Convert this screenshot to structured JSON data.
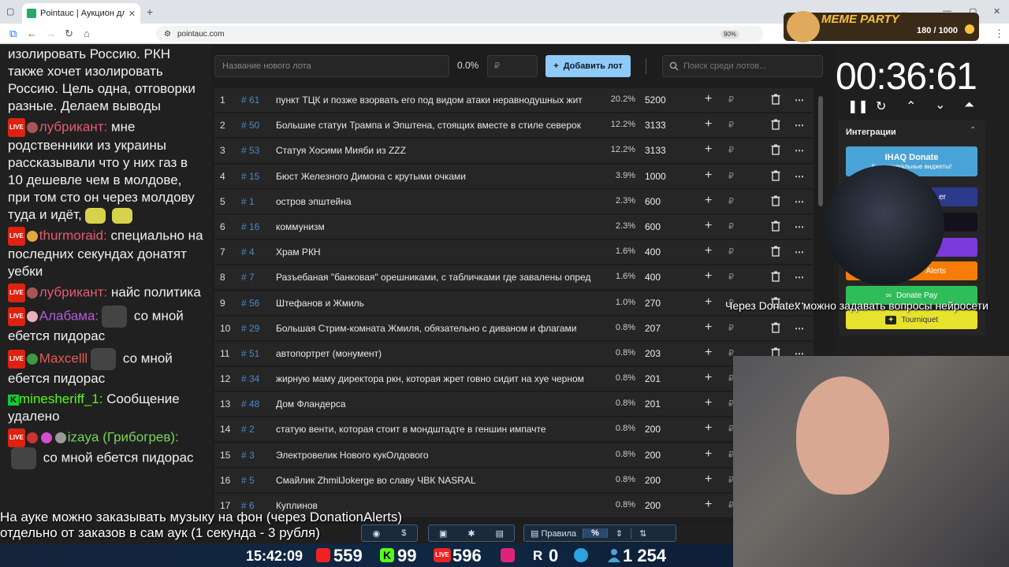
{
  "browser": {
    "tab_title": "Pointauc | Аукцион для стрима",
    "url": "pointauc.com",
    "zoom": "90%"
  },
  "meme_party": {
    "title": "MEME PARTY",
    "count": "180 / 1000"
  },
  "chat": {
    "line0": "изолировать Россию. РКН также хочет изолировать Россию. Цель одна, отговорки разные. Делаем выводы",
    "m1_user": "лубрикант:",
    "m1_text": " мне родственники из украины рассказывали что у них газ в 10 дешевле чем в молдове, при том сто он через молдову туда и идёт,",
    "m2_user": "thurmoraid:",
    "m2_text": " специально на последних секундах донатят уебки",
    "m3_user": "лубрикант:",
    "m3_text": " найс политика",
    "m4_user": "Алабама:",
    "m4_text": " со мной ебется пидорас",
    "m5_user": "Maxcelll",
    "m5_text": " со мной ебется пидорас",
    "m6_user": "minesheriff_1:",
    "m6_text": " Сообщение удалено",
    "m7_user": "izaya (Грибогрев):",
    "m7_text": " со мной ебется пидорас",
    "live_label": "LIVE",
    "kick_label": "K"
  },
  "controls": {
    "lot_placeholder": "Название нового лота",
    "total_percent": "0.0%",
    "amount_placeholder": "₽",
    "add_lot": "Добавить лот",
    "search_placeholder": "Поиск среди лотов..."
  },
  "lots": [
    {
      "n": "1",
      "id": "# 61",
      "name": "пункт ТЦК и позже взорвать его под видом атаки неравнодушных жит",
      "pct": "20.2%",
      "amt": "5200"
    },
    {
      "n": "2",
      "id": "# 50",
      "name": "Большие статуи Трампа и Эпштена, стоящих вместе в стиле северок",
      "pct": "12.2%",
      "amt": "3133"
    },
    {
      "n": "3",
      "id": "# 53",
      "name": "Статуя Хосими Мияби из ZZZ",
      "pct": "12.2%",
      "amt": "3133"
    },
    {
      "n": "4",
      "id": "# 15",
      "name": "Бюст Железного Димона с крутыми очками",
      "pct": "3.9%",
      "amt": "1000"
    },
    {
      "n": "5",
      "id": "# 1",
      "name": "остров эпштейна",
      "pct": "2.3%",
      "amt": "600"
    },
    {
      "n": "6",
      "id": "# 16",
      "name": "коммунизм",
      "pct": "2.3%",
      "amt": "600"
    },
    {
      "n": "7",
      "id": "# 4",
      "name": "Храм РКН",
      "pct": "1.6%",
      "amt": "400"
    },
    {
      "n": "8",
      "id": "# 7",
      "name": "Разъебаная \"банковая\" орешниками, с табличками где завалены опред",
      "pct": "1.6%",
      "amt": "400"
    },
    {
      "n": "9",
      "id": "# 56",
      "name": "Штефанов и Жмиль",
      "pct": "1.0%",
      "amt": "270"
    },
    {
      "n": "10",
      "id": "# 29",
      "name": "Большая Стрим-комната Жмиля, обязательно с диваном и флагами",
      "pct": "0.8%",
      "amt": "207"
    },
    {
      "n": "11",
      "id": "# 51",
      "name": "автопортрет (монумент)",
      "pct": "0.8%",
      "amt": "203"
    },
    {
      "n": "12",
      "id": "# 34",
      "name": "жирную маму директора ркн, которая жрет говно сидит на хуе черном",
      "pct": "0.8%",
      "amt": "201"
    },
    {
      "n": "13",
      "id": "# 48",
      "name": "Дом Фландерса",
      "pct": "0.8%",
      "amt": "201"
    },
    {
      "n": "14",
      "id": "# 2",
      "name": "статую венти, которая стоит в мондштадте в геншин импачте",
      "pct": "0.8%",
      "amt": "200"
    },
    {
      "n": "15",
      "id": "# 3",
      "name": "Электровелик Нового кукОлдового",
      "pct": "0.8%",
      "amt": "200"
    },
    {
      "n": "16",
      "id": "# 5",
      "name": "Смайлик ZhmilJokerge во славу ЧВК NASRAL",
      "pct": "0.8%",
      "amt": "200"
    },
    {
      "n": "17",
      "id": "# 6",
      "name": "Куплинов",
      "pct": "0.8%",
      "amt": "200"
    }
  ],
  "lot_currency": "₽",
  "timer": {
    "value": "00:36:61"
  },
  "integrations": {
    "title": "Интеграции",
    "ihaq": "IHAQ Donate",
    "ihaq_sub": "К... ...уникальные виджеты!",
    "b2": "...er",
    "b5": "Alerts",
    "donatepay": "Donate Pay",
    "tourniquet": "Tourniquet"
  },
  "overlay": {
    "donatex": "Через Donatex можно задавать вопросы нейросети",
    "music1": "На ауке можно заказывать музыку на фон (через DonationAlerts)",
    "music2": "отдельно от заказов в сам аук (1 секунда - 3 рубля)"
  },
  "toolbar": {
    "rules": "Правила",
    "percent": "%"
  },
  "stats": {
    "time": "15:42:09",
    "youtube": "559",
    "kick": "99",
    "vk": "596",
    "rutube": "0",
    "viewers": "1 254",
    "kick_glyph": "K",
    "vk_glyph": "LIVE",
    "rutube_glyph": "R"
  },
  "colors": {
    "accent_blue": "#90caf9",
    "lot_id": "#4a88c7",
    "ihaq": "#4aa3d6",
    "donatepay": "#2ebd59",
    "tourniquet": "#e6e22e",
    "alerts": "#f57d07",
    "purple": "#7b39d9"
  }
}
